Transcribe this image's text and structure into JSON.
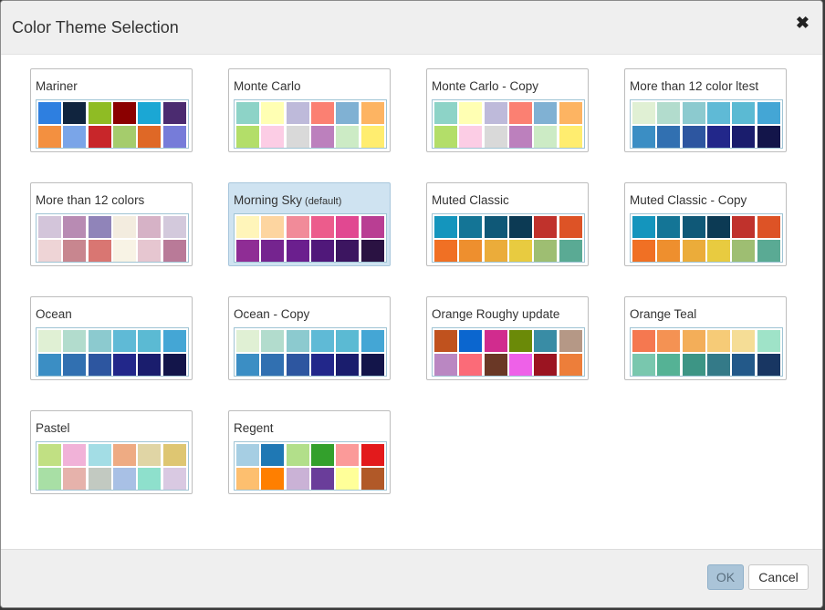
{
  "dialog": {
    "title": "Color Theme Selection",
    "close_glyph": "✖",
    "ok_label": "OK",
    "cancel_label": "Cancel"
  },
  "themes": [
    {
      "name": "Mariner",
      "colors": [
        "#2e7fe0",
        "#10243e",
        "#8fbc24",
        "#8b0000",
        "#1ba7d4",
        "#4b2b70",
        "#f39040",
        "#7aa5e8",
        "#c8262a",
        "#a5cc6c",
        "#df6826",
        "#767cd9"
      ]
    },
    {
      "name": "Monte Carlo",
      "colors": [
        "#8dd3c7",
        "#ffffb3",
        "#bebada",
        "#fb8072",
        "#80b1d3",
        "#fdb462",
        "#b3de69",
        "#fccde5",
        "#d9d9d9",
        "#bc80bd",
        "#ccebc5",
        "#ffed6f"
      ]
    },
    {
      "name": "Monte Carlo - Copy",
      "colors": [
        "#8dd3c7",
        "#ffffb3",
        "#bebada",
        "#fb8072",
        "#80b1d3",
        "#fdb462",
        "#b3de69",
        "#fccde5",
        "#d9d9d9",
        "#bc80bd",
        "#ccebc5",
        "#ffed6f"
      ]
    },
    {
      "name": "More than 12 color ltest",
      "colors": [
        "#e0f0d4",
        "#b2dccd",
        "#8ccacf",
        "#5fbad6",
        "#5bbad3",
        "#44a6d5",
        "#3b8ec4",
        "#3170b1",
        "#2d56a0",
        "#22278a",
        "#1a1d6d",
        "#13154a"
      ]
    },
    {
      "name": "More than 12 colors",
      "colors": [
        "#d3c5da",
        "#b88bb3",
        "#9084b9",
        "#f3ecdf",
        "#d6b2c6",
        "#d3c9dc",
        "#eed4d6",
        "#c8868f",
        "#d97672",
        "#f8f3e5",
        "#e6c6d0",
        "#b97a98"
      ]
    },
    {
      "name": "Morning Sky",
      "default_label": "(default)",
      "selected": true,
      "colors": [
        "#fff5ba",
        "#fdd5a0",
        "#f18b99",
        "#ec5c8c",
        "#e14891",
        "#b93e93",
        "#8f2d95",
        "#75248f",
        "#6b1f8e",
        "#50187a",
        "#3c1560",
        "#2a1242"
      ]
    },
    {
      "name": "Muted Classic",
      "colors": [
        "#1495bd",
        "#147596",
        "#0f5877",
        "#0c3a54",
        "#c0322c",
        "#dd5326",
        "#f07024",
        "#ee8f2e",
        "#ebac3a",
        "#e8cb40",
        "#9ebe72",
        "#5aaa94"
      ]
    },
    {
      "name": "Muted Classic - Copy",
      "colors": [
        "#1495bd",
        "#147596",
        "#0f5877",
        "#0c3a54",
        "#c0322c",
        "#dd5326",
        "#f07024",
        "#ee8f2e",
        "#ebac3a",
        "#e8cb40",
        "#9ebe72",
        "#5aaa94"
      ]
    },
    {
      "name": "Ocean",
      "colors": [
        "#e0f0d4",
        "#b2dccd",
        "#8ccacf",
        "#5fbad6",
        "#5bbad3",
        "#44a6d5",
        "#3b8ec4",
        "#3170b1",
        "#2d56a0",
        "#22278a",
        "#1a1d6d",
        "#13154a"
      ]
    },
    {
      "name": "Ocean - Copy",
      "colors": [
        "#e0f0d4",
        "#b2dccd",
        "#8ccacf",
        "#5fbad6",
        "#5bbad3",
        "#44a6d5",
        "#3b8ec4",
        "#3170b1",
        "#2d56a0",
        "#22278a",
        "#1a1d6d",
        "#13154a"
      ]
    },
    {
      "name": "Orange Roughy update",
      "colors": [
        "#c0521e",
        "#0b66cf",
        "#d12c8e",
        "#6b8a08",
        "#398ca5",
        "#b59886",
        "#ba87c2",
        "#fb6b78",
        "#6a3826",
        "#ee61e8",
        "#9b1421",
        "#ed7e3a"
      ]
    },
    {
      "name": "Orange Teal",
      "colors": [
        "#f57850",
        "#f49253",
        "#f3ae59",
        "#f6cb77",
        "#f5dd96",
        "#9fe3c8",
        "#79c7ae",
        "#55b295",
        "#3d9585",
        "#347a88",
        "#235989",
        "#183662"
      ]
    },
    {
      "name": "Pastel",
      "colors": [
        "#c1e083",
        "#f1b2d8",
        "#a3dde5",
        "#eeab83",
        "#e0d5a5",
        "#dec672",
        "#a8dfa5",
        "#e6b2ab",
        "#c2c9c1",
        "#a8c0e5",
        "#8ee0cc",
        "#d9c9e2"
      ]
    },
    {
      "name": "Regent",
      "colors": [
        "#a6cee3",
        "#1f78b4",
        "#b2df8a",
        "#33a02c",
        "#fb9a99",
        "#e31a1c",
        "#fdbf6f",
        "#ff7f00",
        "#cab2d6",
        "#6a3d9a",
        "#ffff99",
        "#b15928"
      ]
    }
  ]
}
